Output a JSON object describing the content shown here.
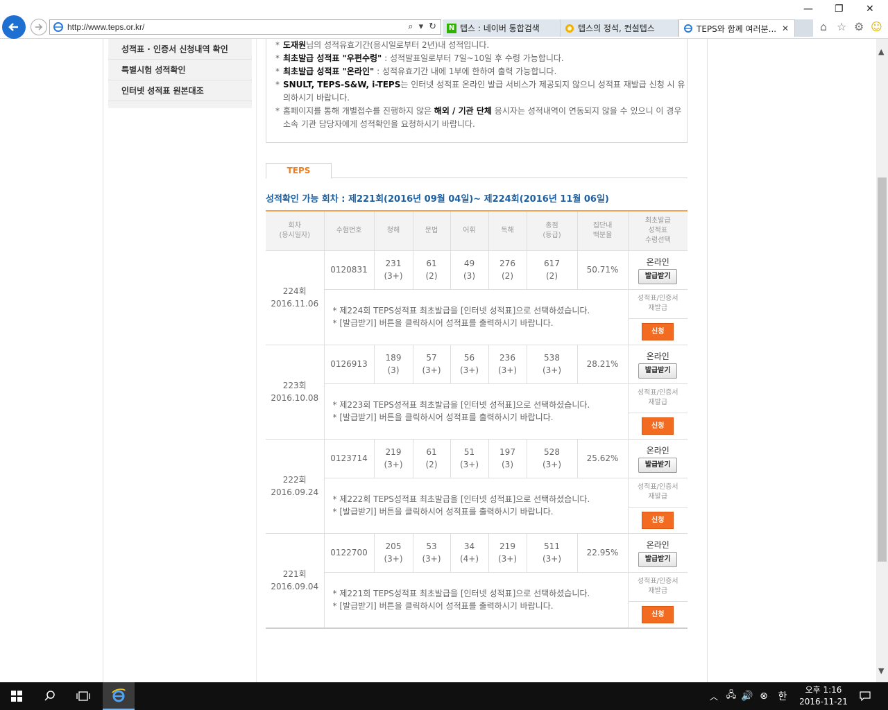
{
  "browser": {
    "url": "http://www.teps.or.kr/",
    "tabs": [
      {
        "label": "텝스 : 네이버 통합검색",
        "icon": "naver-icon"
      },
      {
        "label": "텝스의 정석, 컨설텝스",
        "icon": "consultteps-icon"
      },
      {
        "label": "TEPS와 함께 여러분...",
        "icon": "ie-icon"
      }
    ],
    "naver_letter": "N"
  },
  "sidebar": {
    "items": [
      {
        "label": "성적표 · 인증서 신청내역 확인"
      },
      {
        "label": "특별시험 성적확인"
      },
      {
        "label": "인터넷 성적표 원본대조"
      }
    ]
  },
  "notice": {
    "line1_bold": "도재원",
    "line1_rest": "님의 성적유효기간(응시일로부터 2년)내 성적입니다.",
    "line2_bold": "최초발급 성적표 \"우편수령\"",
    "line2_rest": " : 성적발표일로부터 7일~10일 후 수령 가능합니다.",
    "line3_bold": "최초발급 성적표 \"온라인\"",
    "line3_rest": " : 성적유효기간 내에 1부에 한하여 출력 가능합니다.",
    "line4_bold": "SNULT, TEPS-S&W, i-TEPS",
    "line4_rest": "는 인터넷 성적표 온라인 발급 서비스가 제공되지 않으니 성적표 재발급 신청 시 유의하시기 바랍니다.",
    "line5_pre": "홈페이지를 통해 개별접수를 진행하지 않은 ",
    "line5_bold": "해외 / 기관 단체",
    "line5_rest": " 응시자는 성적내역이 연동되지 않을 수 있으니 이 경우 소속 기관 담당자에게 성적확인을 요청하시기 바랍니다."
  },
  "tab_label": "TEPS",
  "session_title": "성적확인 가능 회차 : 제221회(2016년 09월 04일)~ 제224회(2016년 11월 06일)",
  "table": {
    "headers": {
      "session": [
        "회차",
        "(응시일자)"
      ],
      "exam_no": "수험번호",
      "listening": "청해",
      "grammar": "문법",
      "vocab": "어휘",
      "reading": "독해",
      "total": [
        "총점",
        "(등급)"
      ],
      "percentile": [
        "집단내",
        "백분율"
      ],
      "issue": [
        "최초발급",
        "성적표",
        "수령선택"
      ]
    },
    "online_label": "온라인",
    "issue_button": "발급받기",
    "reissue_label": [
      "성적표/인증서",
      "재발급"
    ],
    "apply_button": "신청",
    "rows": [
      {
        "session": "224회",
        "date": "2016.11.06",
        "exam_no": "0120831",
        "listening": "231",
        "listening_g": "(3+)",
        "grammar": "61",
        "grammar_g": "(2)",
        "vocab": "49",
        "vocab_g": "(3)",
        "reading": "276",
        "reading_g": "(2)",
        "total": "617",
        "total_g": "(2)",
        "percentile": "50.71%",
        "msg1": "* 제224회 TEPS성적표 최초발급을 [인터넷 성적표]으로 선택하셨습니다.",
        "msg2": "* [발급받기] 버튼을 클릭하시어 성적표를 출력하시기 바랍니다."
      },
      {
        "session": "223회",
        "date": "2016.10.08",
        "exam_no": "0126913",
        "listening": "189",
        "listening_g": "(3)",
        "grammar": "57",
        "grammar_g": "(3+)",
        "vocab": "56",
        "vocab_g": "(3+)",
        "reading": "236",
        "reading_g": "(3+)",
        "total": "538",
        "total_g": "(3+)",
        "percentile": "28.21%",
        "msg1": "* 제223회 TEPS성적표 최초발급을 [인터넷 성적표]으로 선택하셨습니다.",
        "msg2": "* [발급받기] 버튼을 클릭하시어 성적표를 출력하시기 바랍니다."
      },
      {
        "session": "222회",
        "date": "2016.09.24",
        "exam_no": "0123714",
        "listening": "219",
        "listening_g": "(3+)",
        "grammar": "61",
        "grammar_g": "(2)",
        "vocab": "51",
        "vocab_g": "(3+)",
        "reading": "197",
        "reading_g": "(3)",
        "total": "528",
        "total_g": "(3+)",
        "percentile": "25.62%",
        "msg1": "* 제222회 TEPS성적표 최초발급을 [인터넷 성적표]으로 선택하셨습니다.",
        "msg2": "* [발급받기] 버튼을 클릭하시어 성적표를 출력하시기 바랍니다."
      },
      {
        "session": "221회",
        "date": "2016.09.04",
        "exam_no": "0122700",
        "listening": "205",
        "listening_g": "(3+)",
        "grammar": "53",
        "grammar_g": "(3+)",
        "vocab": "34",
        "vocab_g": "(4+)",
        "reading": "219",
        "reading_g": "(3+)",
        "total": "511",
        "total_g": "(3+)",
        "percentile": "22.95%",
        "msg1": "* 제221회 TEPS성적표 최초발급을 [인터넷 성적표]으로 선택하셨습니다.",
        "msg2": "* [발급받기] 버튼을 클릭하시어 성적표를 출력하시기 바랍니다."
      }
    ]
  },
  "taskbar": {
    "time": "오후 1:16",
    "date": "2016-11-21",
    "ime": "한"
  },
  "colors": {
    "accent_orange": "#f26b21",
    "title_blue": "#1d5f9f",
    "ie_blue": "#1d6fd1"
  }
}
